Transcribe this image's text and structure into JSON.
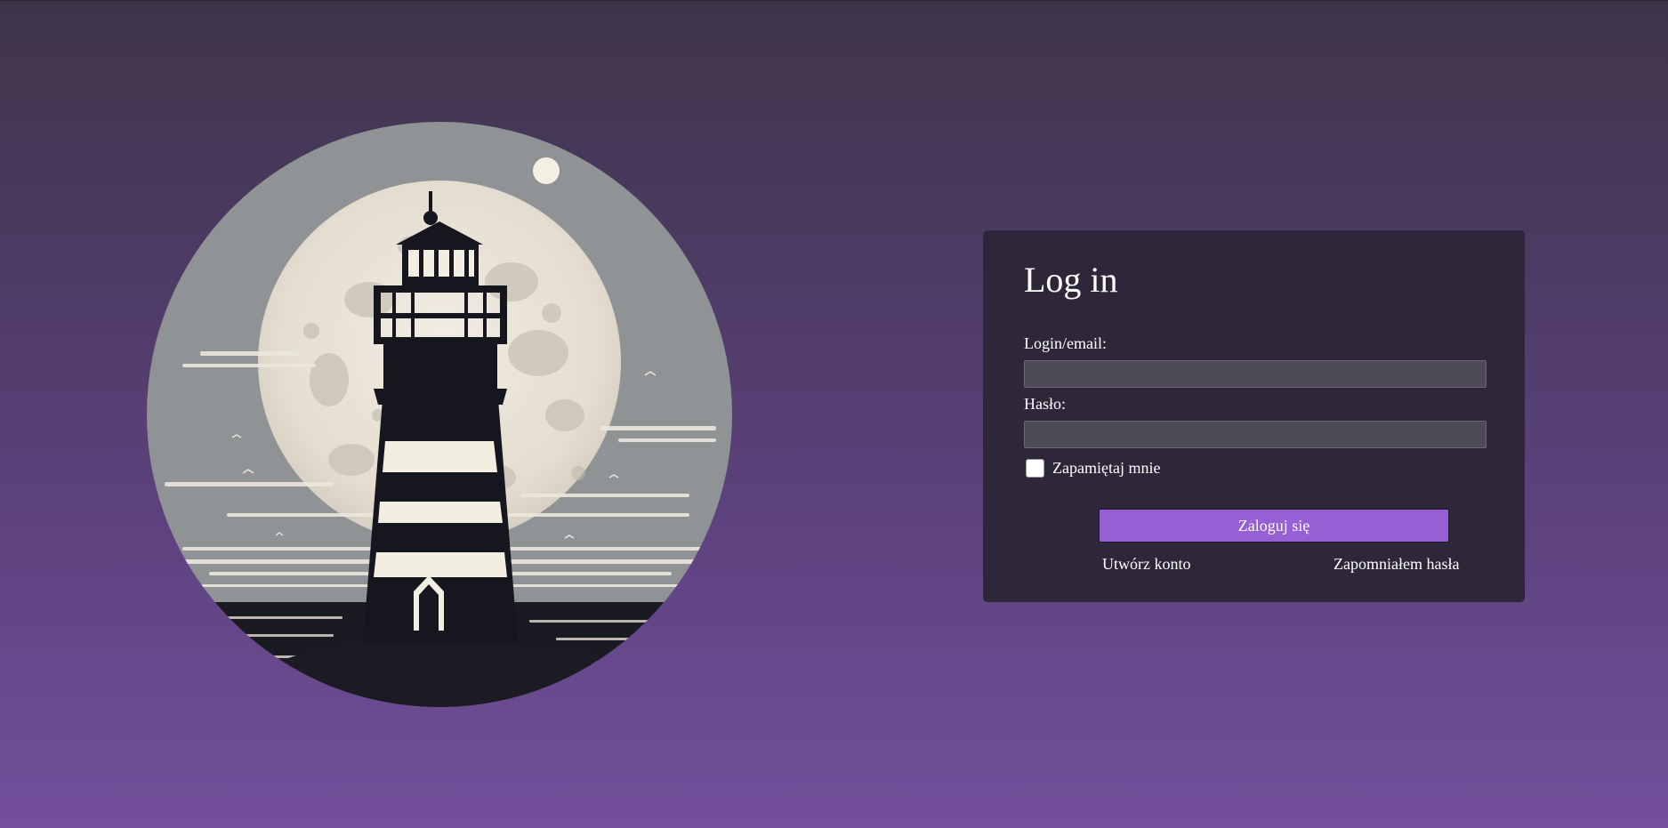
{
  "login": {
    "title": "Log in",
    "login_label": "Login/email:",
    "login_value": "",
    "password_label": "Hasło:",
    "password_value": "",
    "remember_label": "Zapamiętaj mnie",
    "remember_checked": false,
    "submit_label": "Zaloguj się",
    "create_account_label": "Utwórz konto",
    "forgot_password_label": "Zapomniałem hasła"
  },
  "illustration": {
    "subject": "lighthouse-under-full-moon"
  },
  "colors": {
    "background_top": "#3e3549",
    "background_bottom": "#744f9c",
    "card": "#2e2639",
    "input": "#4f4a57",
    "button": "#9660d4"
  }
}
